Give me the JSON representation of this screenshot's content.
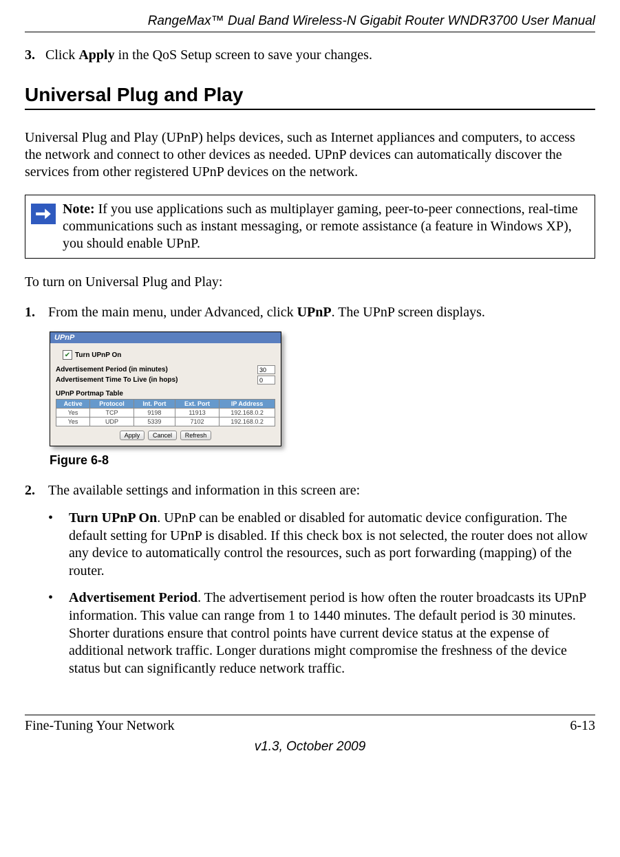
{
  "header": {
    "title": "RangeMax™ Dual Band Wireless-N Gigabit Router WNDR3700 User Manual"
  },
  "step3": {
    "num": "3.",
    "pre": "Click ",
    "bold": "Apply",
    "post": " in the QoS Setup screen to save your changes."
  },
  "section_title": "Universal Plug and Play",
  "intro": "Universal Plug and Play (UPnP) helps devices, such as Internet appliances and computers, to access the network and connect to other devices as needed. UPnP devices can automatically discover the services from other registered UPnP devices on the network.",
  "note": {
    "label": "Note:",
    "text": " If you use applications such as multiplayer gaming, peer-to-peer connections, real-time communications such as instant messaging, or remote assistance (a feature in Windows XP), you should enable UPnP."
  },
  "turn_on_lead": "To turn on Universal Plug and Play:",
  "step1": {
    "num": "1.",
    "pre": "From the main menu, under Advanced, click ",
    "bold": "UPnP",
    "post": ". The UPnP screen displays."
  },
  "upnp_panel": {
    "title": "UPnP",
    "checkbox_label": "Turn UPnP On",
    "adv_period_label": "Advertisement Period (in minutes)",
    "adv_period_value": "30",
    "adv_ttl_label": "Advertisement Time To Live (in hops)",
    "adv_ttl_value": "0",
    "portmap_title": "UPnP Portmap Table",
    "headers": [
      "Active",
      "Protocol",
      "Int. Port",
      "Ext. Port",
      "IP Address"
    ],
    "rows": [
      [
        "Yes",
        "TCP",
        "9198",
        "11913",
        "192.168.0.2"
      ],
      [
        "Yes",
        "UDP",
        "5339",
        "7102",
        "192.168.0.2"
      ]
    ],
    "buttons": {
      "apply": "Apply",
      "cancel": "Cancel",
      "refresh": "Refresh"
    }
  },
  "figure_caption": "Figure 6-8",
  "step2": {
    "num": "2.",
    "text": "The available settings and information in this screen are:"
  },
  "bullets": [
    {
      "bold": "Turn UPnP On",
      "text": ". UPnP can be enabled or disabled for automatic device configuration. The default setting for UPnP is disabled. If this check box is not selected, the router does not allow any device to automatically control the resources, such as port forwarding (mapping) of the router."
    },
    {
      "bold": "Advertisement Period",
      "text": ". The advertisement period is how often the router broadcasts its UPnP information. This value can range from 1 to 1440 minutes. The default period is 30 minutes. Shorter durations ensure that control points have current device status at the expense of additional network traffic. Longer durations might compromise the freshness of the device status but can significantly reduce network traffic."
    }
  ],
  "footer": {
    "left": "Fine-Tuning Your Network",
    "right": "6-13",
    "version": "v1.3, October 2009"
  }
}
